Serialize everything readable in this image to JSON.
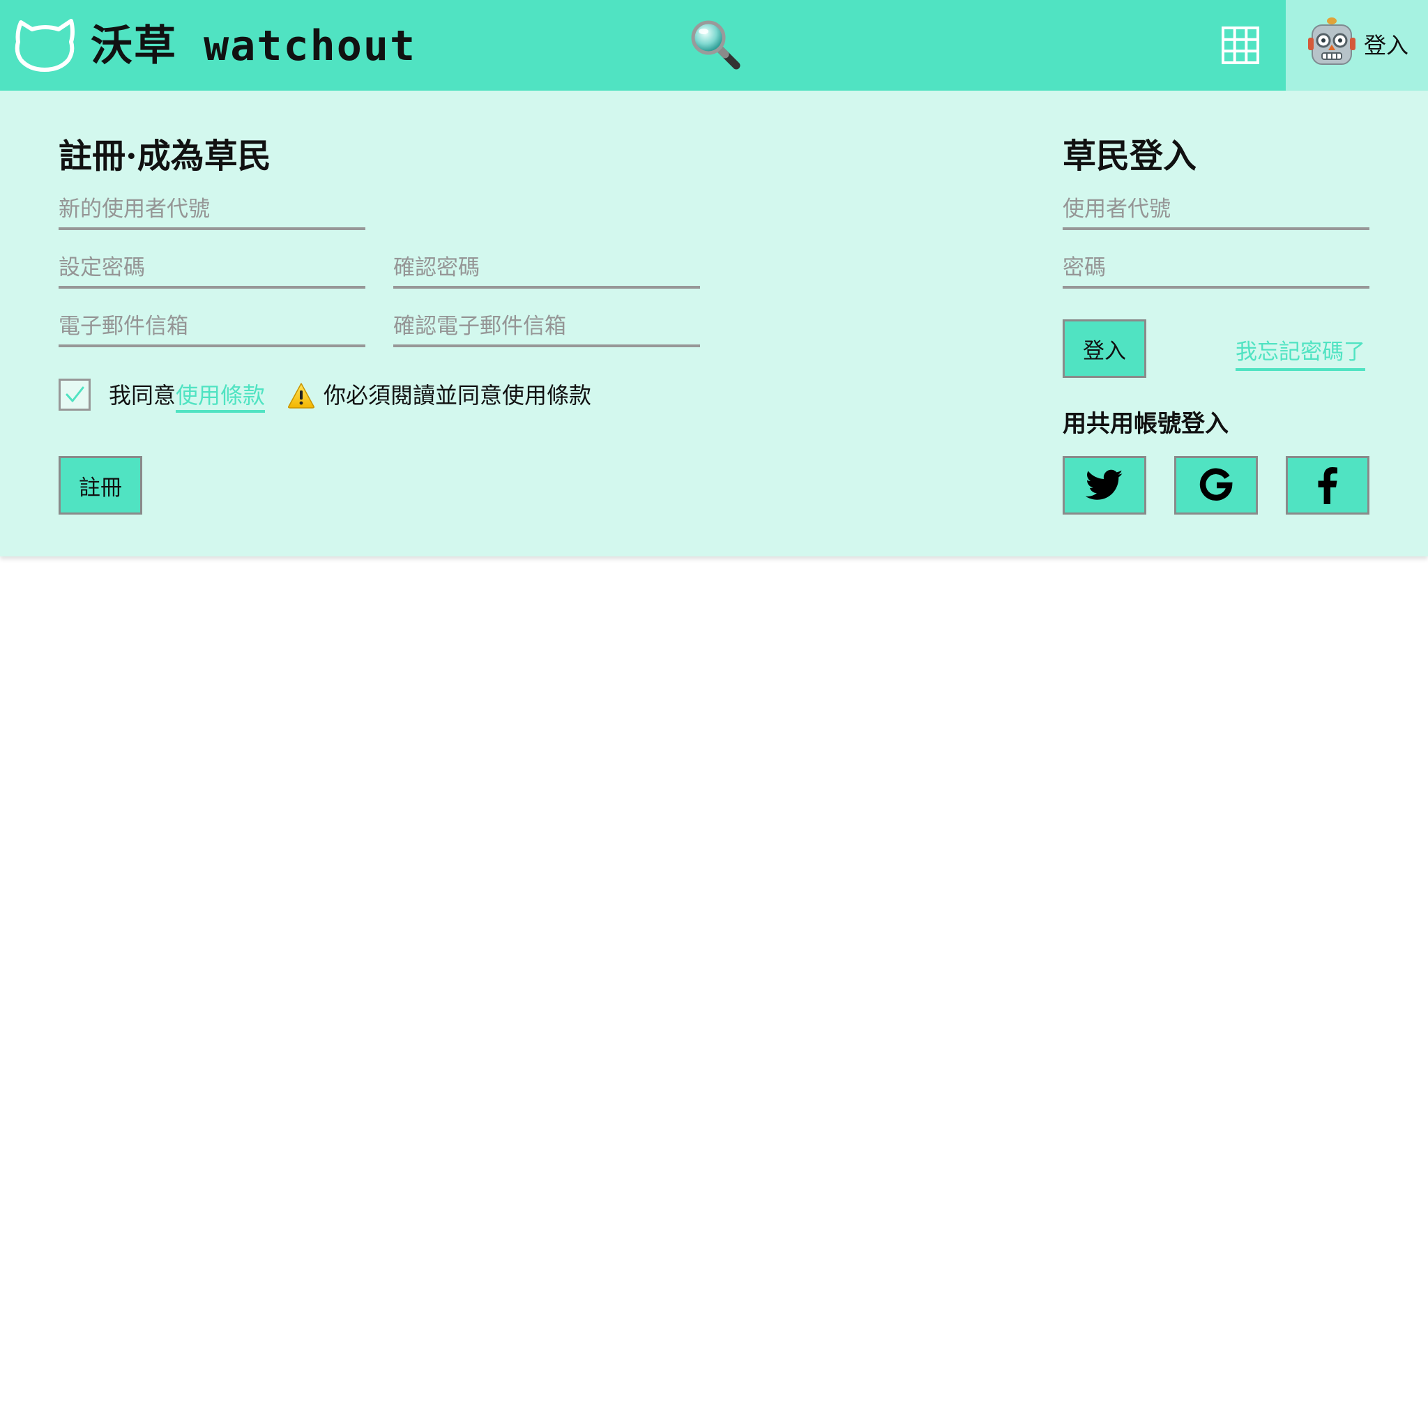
{
  "header": {
    "brand": "沃草 watchout",
    "user_login_label": "登入"
  },
  "register": {
    "title": "註冊·成為草民",
    "username_placeholder": "新的使用者代號",
    "password_placeholder": "設定密碼",
    "confirm_password_placeholder": "確認密碼",
    "email_placeholder": "電子郵件信箱",
    "confirm_email_placeholder": "確認電子郵件信箱",
    "agree_prefix": "我同意",
    "terms_link": "使用條款",
    "warning": "你必須閱讀並同意使用條款",
    "submit_label": "註冊"
  },
  "login": {
    "title": "草民登入",
    "username_placeholder": "使用者代號",
    "password_placeholder": "密碼",
    "submit_label": "登入",
    "forgot_link": "我忘記密碼了",
    "social_title": "用共用帳號登入"
  },
  "icons": {
    "logo": "cat-logo-icon",
    "search": "magnifier-icon",
    "apps": "grid-icon",
    "avatar": "robot-icon",
    "warning": "warning-icon",
    "checkbox": "check-icon",
    "social": [
      "twitter-icon",
      "google-icon",
      "facebook-icon"
    ]
  },
  "colors": {
    "accent": "#50e3c2",
    "panel_background": "#d3f8ee",
    "user_area_background": "#a6f2e1",
    "placeholder": "#959595",
    "underline": "#979797"
  },
  "register_form": {
    "terms_checked": true
  }
}
